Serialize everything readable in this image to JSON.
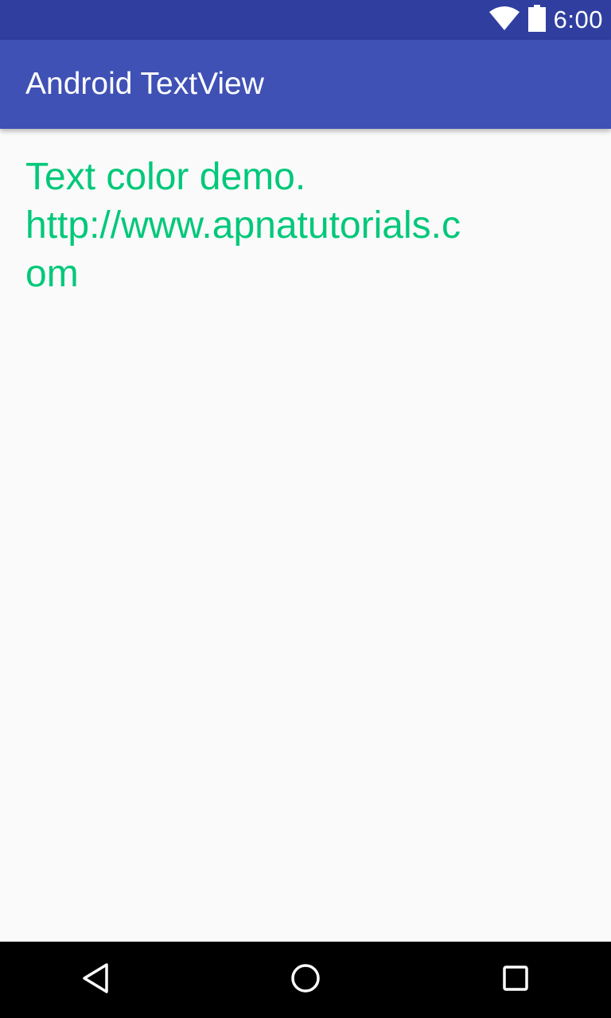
{
  "status_bar": {
    "time": "6:00",
    "icons": [
      "wifi-icon",
      "battery-icon"
    ],
    "background_color": "#303f9f"
  },
  "app_bar": {
    "title": "Android TextView",
    "background_color": "#3f51b5"
  },
  "content": {
    "text": "Text color demo. http://www.apnatutorials.com",
    "text_color": "#00c87a"
  },
  "nav_bar": {
    "buttons": [
      "back-icon",
      "home-icon",
      "recents-icon"
    ]
  }
}
